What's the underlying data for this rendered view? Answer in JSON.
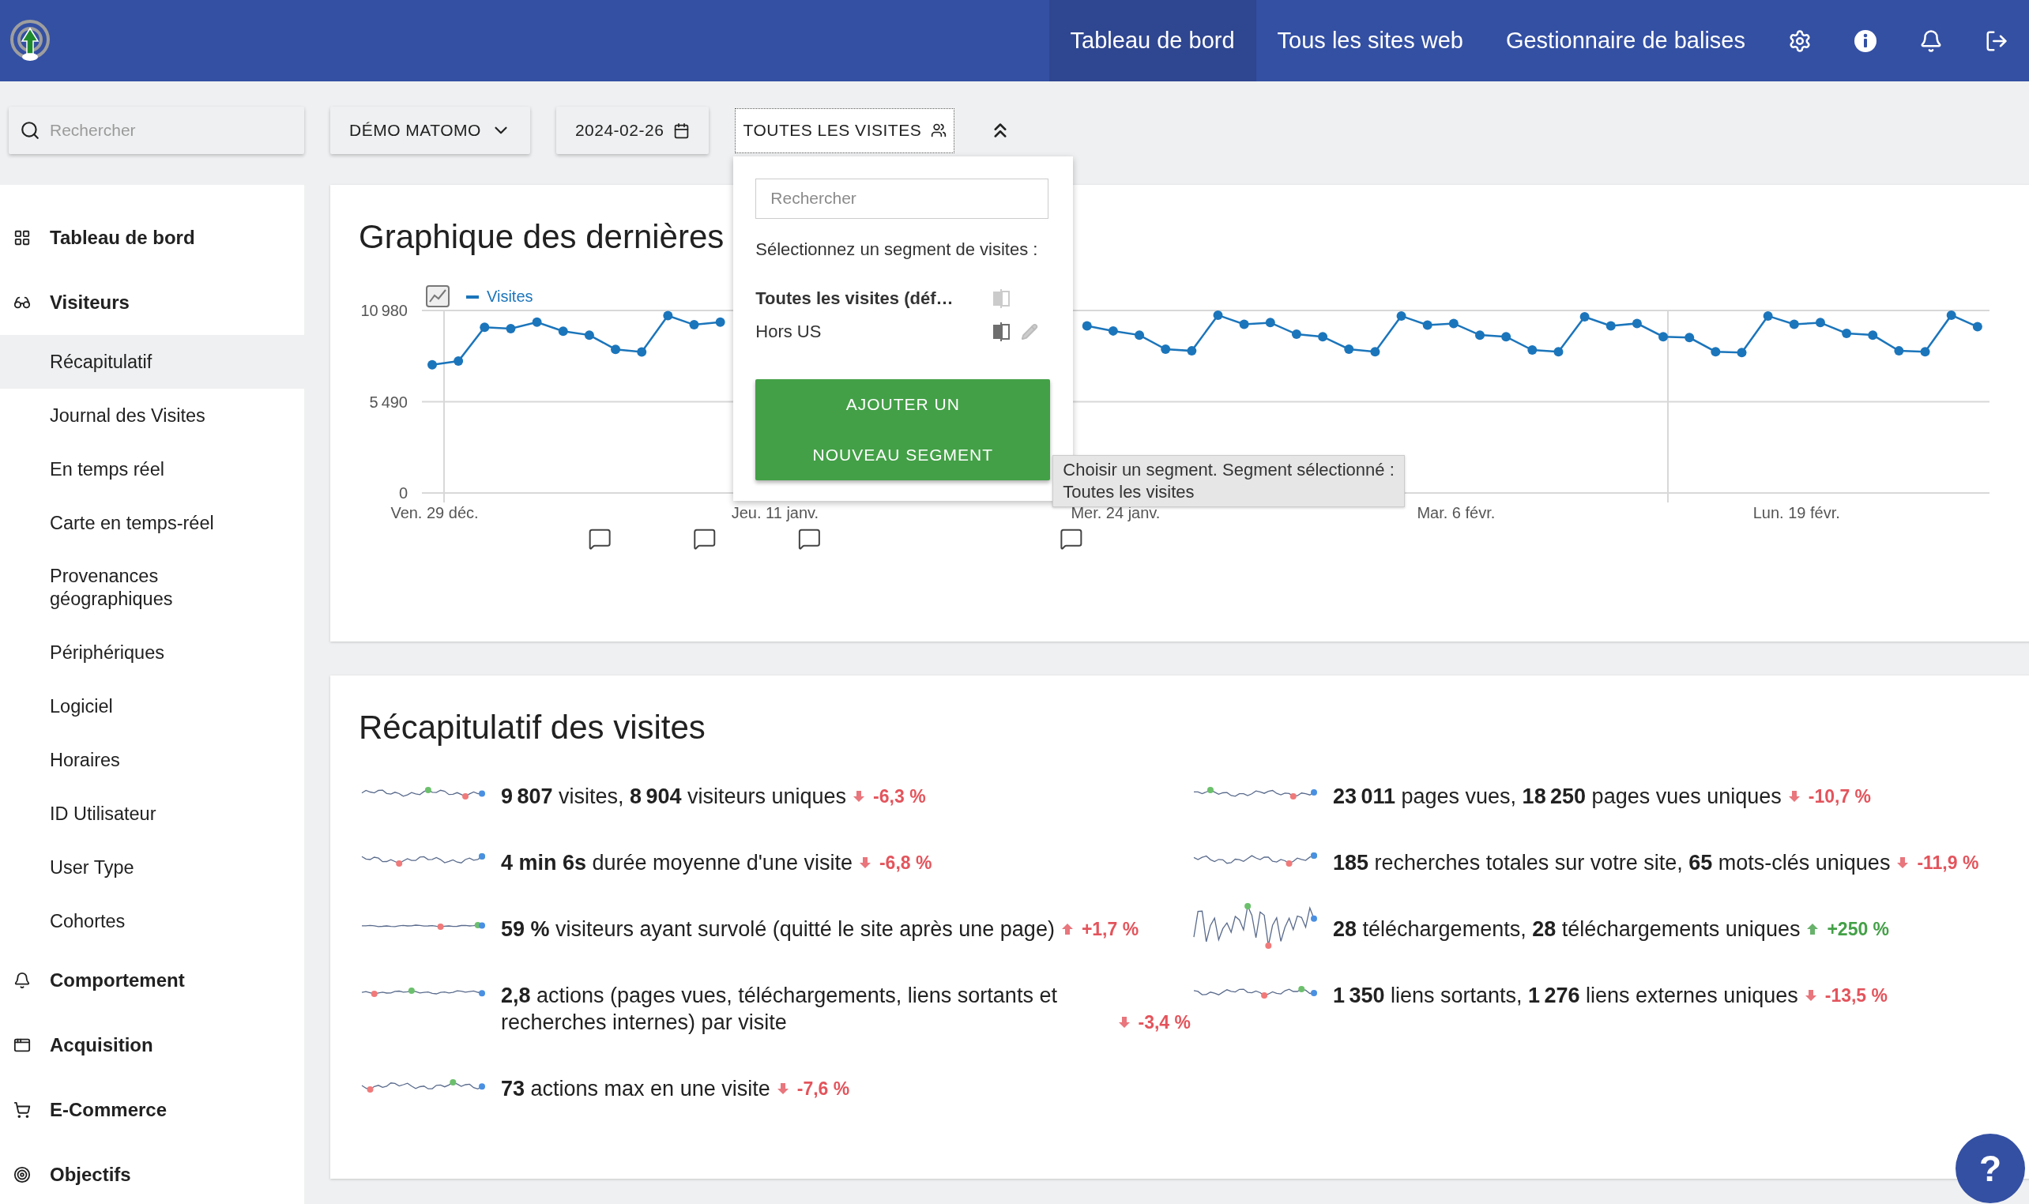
{
  "topbar": {
    "nav": [
      {
        "label": "Tableau de bord",
        "selected": true
      },
      {
        "label": "Tous les sites web",
        "selected": false
      },
      {
        "label": "Gestionnaire de balises",
        "selected": false
      }
    ]
  },
  "toolbar": {
    "search": {
      "placeholder": "Rechercher"
    },
    "site": "DÉMO MATOMO",
    "date": "2024-02-26",
    "segment": "TOUTES LES VISITES"
  },
  "segment_menu": {
    "search": {
      "placeholder": "Rechercher"
    },
    "prompt": "Sélectionnez un segment de visites :",
    "segments": [
      {
        "label": "Toutes les visites (déf…",
        "selected": true,
        "editable": false
      },
      {
        "label": "Hors US",
        "selected": false,
        "editable": true
      }
    ],
    "add_button": "AJOUTER UN NOUVEAU SEGMENT",
    "tooltip": "Choisir un segment. Segment sélectionné :\nToutes les visites"
  },
  "sidebar": {
    "items": [
      {
        "label": "Tableau de bord"
      },
      {
        "label": "Visiteurs",
        "children": [
          {
            "label": "Récapitulatif",
            "selected": true
          },
          {
            "label": "Journal des Visites",
            "selected": false
          },
          {
            "label": "En temps réel",
            "selected": false
          },
          {
            "label": "Carte en temps-réel",
            "selected": false
          },
          {
            "label": "Provenances géographiques",
            "selected": false
          },
          {
            "label": "Périphériques",
            "selected": false
          },
          {
            "label": "Logiciel",
            "selected": false
          },
          {
            "label": "Horaires",
            "selected": false
          },
          {
            "label": "ID Utilisateur",
            "selected": false
          },
          {
            "label": "User Type",
            "selected": false
          },
          {
            "label": "Cohortes",
            "selected": false
          }
        ]
      },
      {
        "label": "Comportement"
      },
      {
        "label": "Acquisition"
      },
      {
        "label": "E-Commerce"
      },
      {
        "label": "Objectifs"
      }
    ]
  },
  "evolution_card": {
    "title": "Graphique des dernières",
    "chart_data": {
      "type": "line",
      "categories": [
        "Ven. 29 déc.",
        null,
        null,
        null,
        null,
        null,
        null,
        null,
        null,
        null,
        null,
        null,
        null,
        "Jeu. 11 janv.",
        null,
        null,
        null,
        null,
        null,
        null,
        null,
        null,
        null,
        null,
        null,
        null,
        "Mer. 24 janv.",
        null,
        null,
        null,
        null,
        null,
        null,
        null,
        null,
        null,
        null,
        null,
        null,
        "Mar. 6 févr.",
        null,
        null,
        null,
        null,
        null,
        null,
        null,
        null,
        null,
        null,
        null,
        null,
        "Lun. 19 févr.",
        null,
        null,
        null,
        null,
        null,
        null,
        null
      ],
      "yticks": [
        {
          "value": 0,
          "label": "0"
        },
        {
          "value": 5490,
          "label": "5 490"
        },
        {
          "value": 10980,
          "label": "10 980"
        }
      ],
      "ylim": [
        0,
        10980
      ],
      "series": [
        {
          "name": "Visites",
          "color": "#1b75bb",
          "marker": true,
          "values": [
            7710,
            7940,
            9970,
            9890,
            10280,
            9730,
            9500,
            8640,
            8490,
            10670,
            10120,
            10280,
            null,
            null,
            null,
            null,
            null,
            null,
            null,
            null,
            null,
            null,
            null,
            null,
            null,
            10050,
            9750,
            9500,
            8650,
            8550,
            10700,
            10150,
            10250,
            9550,
            9400,
            8650,
            8500,
            10650,
            10100,
            10200,
            9500,
            9400,
            8600,
            8500,
            10600,
            10050,
            10200,
            9400,
            9350,
            8500,
            8450,
            10650,
            10150,
            10250,
            9600,
            9500,
            8550,
            8500,
            10700,
            10000
          ]
        }
      ]
    }
  },
  "overview_card": {
    "title": "Récapitulatif des visites",
    "columns": [
      {
        "metrics": [
          {
            "text": "**9 807** visites, **8 904** visiteurs uniques",
            "rising": false,
            "change": "-6,3 %",
            "color": "#e3545c"
          },
          {
            "text": "**4 min 6s** durée moyenne d'une visite",
            "rising": false,
            "change": "-6,8 %",
            "color": "#e3545c"
          },
          {
            "text": "**59 %** visiteurs ayant survolé (quitté le site après une page)",
            "rising": true,
            "change": "+1,7 %",
            "color": "#e3545c"
          },
          {
            "text": "**2,8** actions (pages vues, téléchargements, liens sortants et recherches internes) par visite",
            "rising": false,
            "change": "-3,4 %",
            "color": "#e3545c"
          },
          {
            "text": "**73** actions max en une visite",
            "rising": false,
            "change": "-7,6 %",
            "color": "#e3545c"
          }
        ]
      },
      {
        "metrics": [
          {
            "text": "**23 011** pages vues, **18 250** pages vues uniques",
            "rising": false,
            "change": "-10,7 %",
            "color": "#e3545c"
          },
          {
            "text": "**185** recherches totales sur votre site, **65** mots-clés uniques",
            "rising": false,
            "change": "-11,9 %",
            "color": "#e3545c"
          },
          {
            "text": "**28** téléchargements, **28** téléchargements uniques",
            "rising": true,
            "change": "+250 %",
            "color": "#43a047"
          },
          {
            "text": "**1 350** liens sortants, **1 276** liens externes uniques",
            "rising": false,
            "change": "-13,5 %",
            "color": "#e3545c"
          }
        ]
      }
    ]
  },
  "help_button": "?"
}
